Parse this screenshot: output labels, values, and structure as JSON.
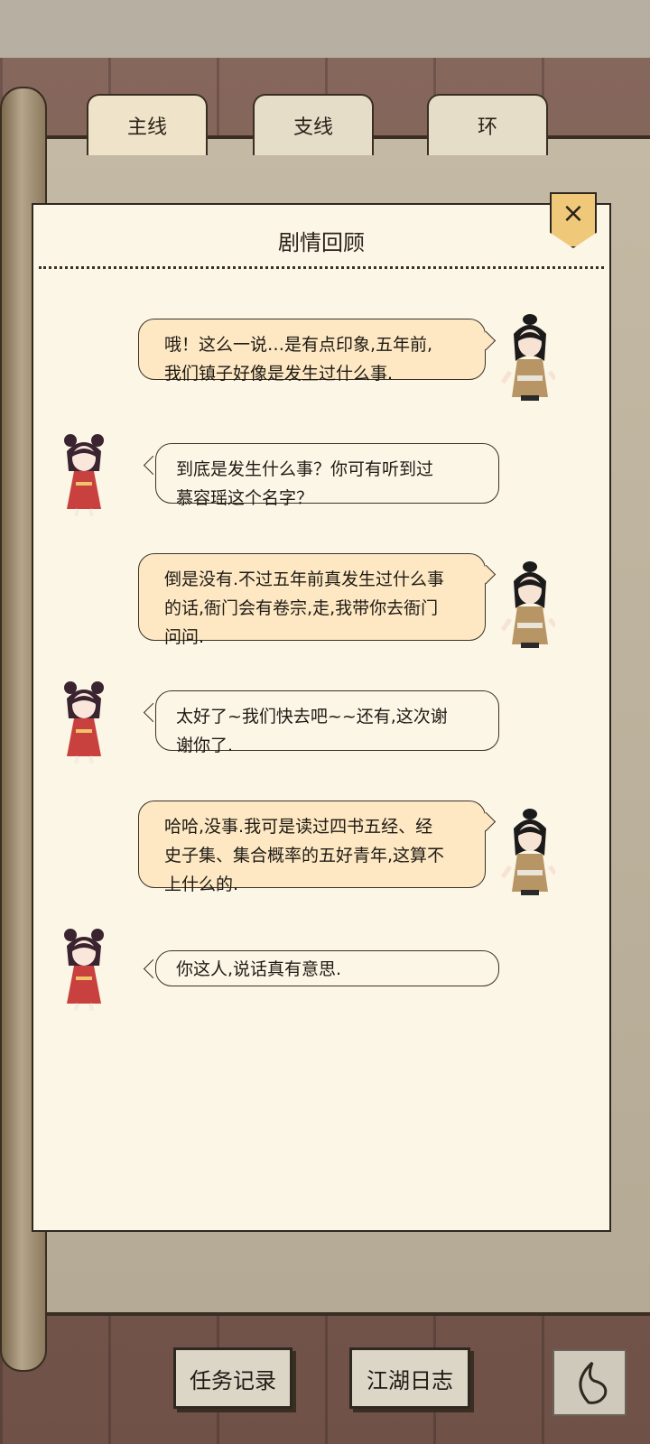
{
  "tabs": [
    {
      "label": "主线"
    },
    {
      "label": "支线"
    },
    {
      "label": "环"
    }
  ],
  "panel": {
    "title": "剧情回顾",
    "close_icon": "×"
  },
  "messages": [
    {
      "speaker": "right",
      "text": "哦！这么一说…是有点印象,五年前,\n我们镇子好像是发生过什么事."
    },
    {
      "speaker": "left",
      "text": "到底是发生什么事？你可有听到过\n慕容瑶这个名字？"
    },
    {
      "speaker": "right",
      "text": "倒是没有.不过五年前真发生过什么事\n的话,衙门会有卷宗,走,我带你去衙门\n问问."
    },
    {
      "speaker": "left",
      "text": "太好了~我们快去吧~~还有,这次谢\n谢你了."
    },
    {
      "speaker": "right",
      "text": "哈哈,没事.我可是读过四书五经、经\n史子集、集合概率的五好青年,这算不\n上什么的."
    },
    {
      "speaker": "left",
      "text": "你这人,说话真有意思."
    }
  ],
  "bottom": {
    "task_log": "任务记录",
    "jianghu_log": "江湖日志",
    "back_icon": "back-icon"
  },
  "colors": {
    "bubble_right": "#fde8c3",
    "bubble_left": "#fcf6e6",
    "panel_bg": "#fcf6e6"
  }
}
